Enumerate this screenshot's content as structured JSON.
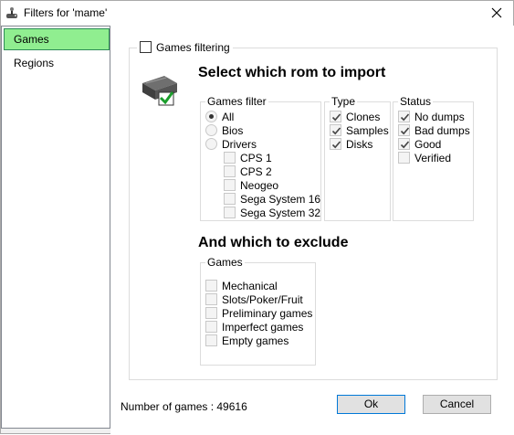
{
  "window": {
    "title": "Filters for 'mame'"
  },
  "sidebar": {
    "items": [
      {
        "label": "Games"
      },
      {
        "label": "Regions"
      }
    ]
  },
  "games_filtering": {
    "label": "Games filtering",
    "checked": false
  },
  "import_heading": "Select which rom to import",
  "games_filter": {
    "legend": "Games filter",
    "options": [
      {
        "label": "All",
        "selected": true
      },
      {
        "label": "Bios",
        "selected": false
      },
      {
        "label": "Drivers",
        "selected": false
      }
    ],
    "drivers": [
      {
        "label": "CPS 1",
        "checked": false
      },
      {
        "label": "CPS 2",
        "checked": false
      },
      {
        "label": "Neogeo",
        "checked": false
      },
      {
        "label": "Sega System 16",
        "checked": false
      },
      {
        "label": "Sega System 32",
        "checked": false
      }
    ]
  },
  "type": {
    "legend": "Type",
    "items": [
      {
        "label": "Clones",
        "checked": true
      },
      {
        "label": "Samples",
        "checked": true
      },
      {
        "label": "Disks",
        "checked": true
      }
    ]
  },
  "status": {
    "legend": "Status",
    "items": [
      {
        "label": "No dumps",
        "checked": true
      },
      {
        "label": "Bad dumps",
        "checked": true
      },
      {
        "label": "Good",
        "checked": true
      },
      {
        "label": "Verified",
        "checked": false
      }
    ]
  },
  "exclude_heading": "And which to exclude",
  "exclude_games": {
    "legend": "Games",
    "items": [
      {
        "label": "Mechanical",
        "checked": false
      },
      {
        "label": "Slots/Poker/Fruit",
        "checked": false
      },
      {
        "label": "Preliminary games",
        "checked": false
      },
      {
        "label": "Imperfect games",
        "checked": false
      },
      {
        "label": "Empty games",
        "checked": false
      }
    ]
  },
  "footer": {
    "count_text": "Number of games : 49616",
    "ok_label": "Ok",
    "cancel_label": "Cancel"
  },
  "colors": {
    "selected_bg": "#90ee90",
    "accent": "#0078d7"
  },
  "icons": {
    "app": "joystick-icon",
    "import": "chip-check-icon",
    "close": "close-icon"
  }
}
